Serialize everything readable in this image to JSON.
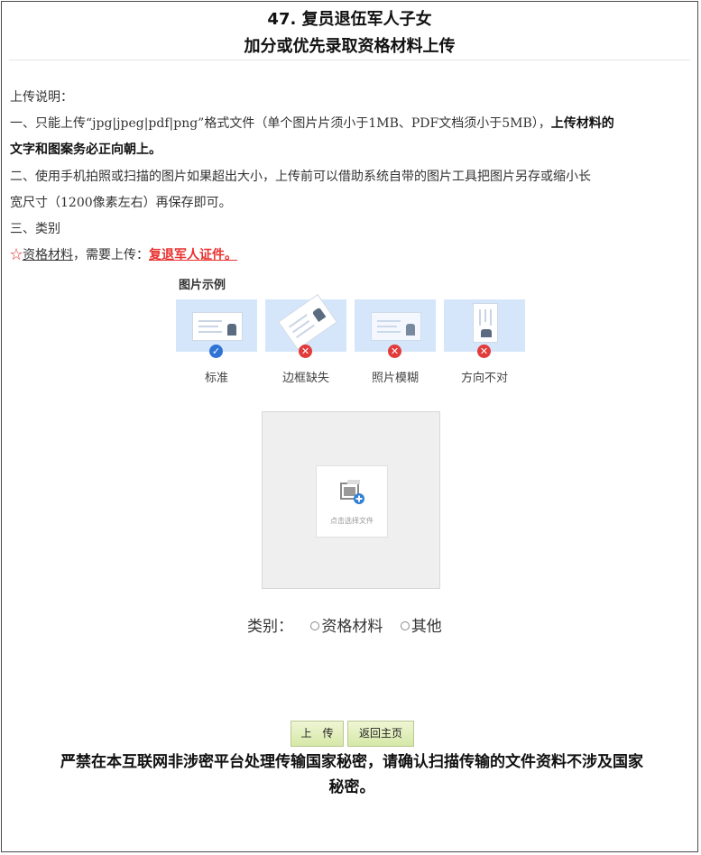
{
  "header": {
    "title_line1": "47. 复员退伍军人子女",
    "title_line2": "加分或优先录取资格材料上传"
  },
  "instructions": {
    "heading": "上传说明：",
    "item1_prefix": "一、只能上传“jpg|jpeg|pdf|png”格式文件（单个图片片须小于1MB、PDF文档须小于5MB），",
    "item1_bold_a": "上传材料的",
    "item1_bold_b": "文字和图案务必正向朝上。",
    "item2_line1": "二、使用手机拍照或扫描的图片如果超出大小，上传前可以借助系统自带的图片工具把图片另存或缩小长",
    "item2_line2": "宽尺寸（1200像素左右）再保存即可。",
    "item3": "三、类别",
    "req_star": "☆",
    "req_type": "资格材料",
    "req_middle": "，需要上传：",
    "req_item": "复退军人证件。"
  },
  "examples": {
    "title": "图片示例",
    "items": [
      {
        "label": "标准",
        "status": "ok"
      },
      {
        "label": "边框缺失",
        "status": "bad"
      },
      {
        "label": "照片模糊",
        "status": "bad"
      },
      {
        "label": "方向不对",
        "status": "bad"
      }
    ]
  },
  "upload": {
    "picker_text": "点击选择文件"
  },
  "category": {
    "label": "类别：",
    "options": [
      "资格材料",
      "其他"
    ]
  },
  "buttons": {
    "upload": "上　传",
    "home": "返回主页"
  },
  "warning": {
    "line1": "严禁在本互联网非涉密平台处理传输国家秘密，请确认扫描传输的文件资料不涉及国家",
    "line2": "秘密。"
  },
  "colors": {
    "accent_red": "#e8312f",
    "ok_blue": "#2f73d6",
    "card_bg": "#d5e6fb",
    "button_bg": "#d6e8a7"
  }
}
